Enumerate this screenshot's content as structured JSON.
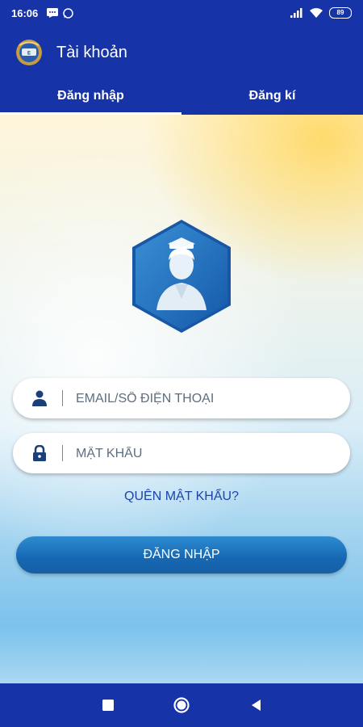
{
  "status_bar": {
    "time": "16:06",
    "battery": "89",
    "icons": [
      "message-icon",
      "whatsapp-icon",
      "signal-icon",
      "wifi-icon",
      "battery-icon"
    ]
  },
  "app_bar": {
    "title": "Tài khoản",
    "logo_icon": "app-logo-icon"
  },
  "tabs": [
    {
      "label": "Đăng nhập",
      "active": true
    },
    {
      "label": "Đăng kí",
      "active": false
    }
  ],
  "form": {
    "email_placeholder": "EMAIL/SỐ ĐIỆN THOẠI",
    "email_value": "",
    "password_placeholder": "MẬT KHẨU",
    "password_value": "",
    "forgot_password": "QUÊN MẬT KHẨU?",
    "login_button": "ĐĂNG NHẬP"
  },
  "avatar_icon": "user-avatar-icon",
  "nav_bar": {
    "buttons": [
      "recent-apps-icon",
      "home-icon",
      "back-icon"
    ]
  },
  "colors": {
    "primary": "#1733a8",
    "button": "#1667b3",
    "link": "#1c45a6"
  }
}
